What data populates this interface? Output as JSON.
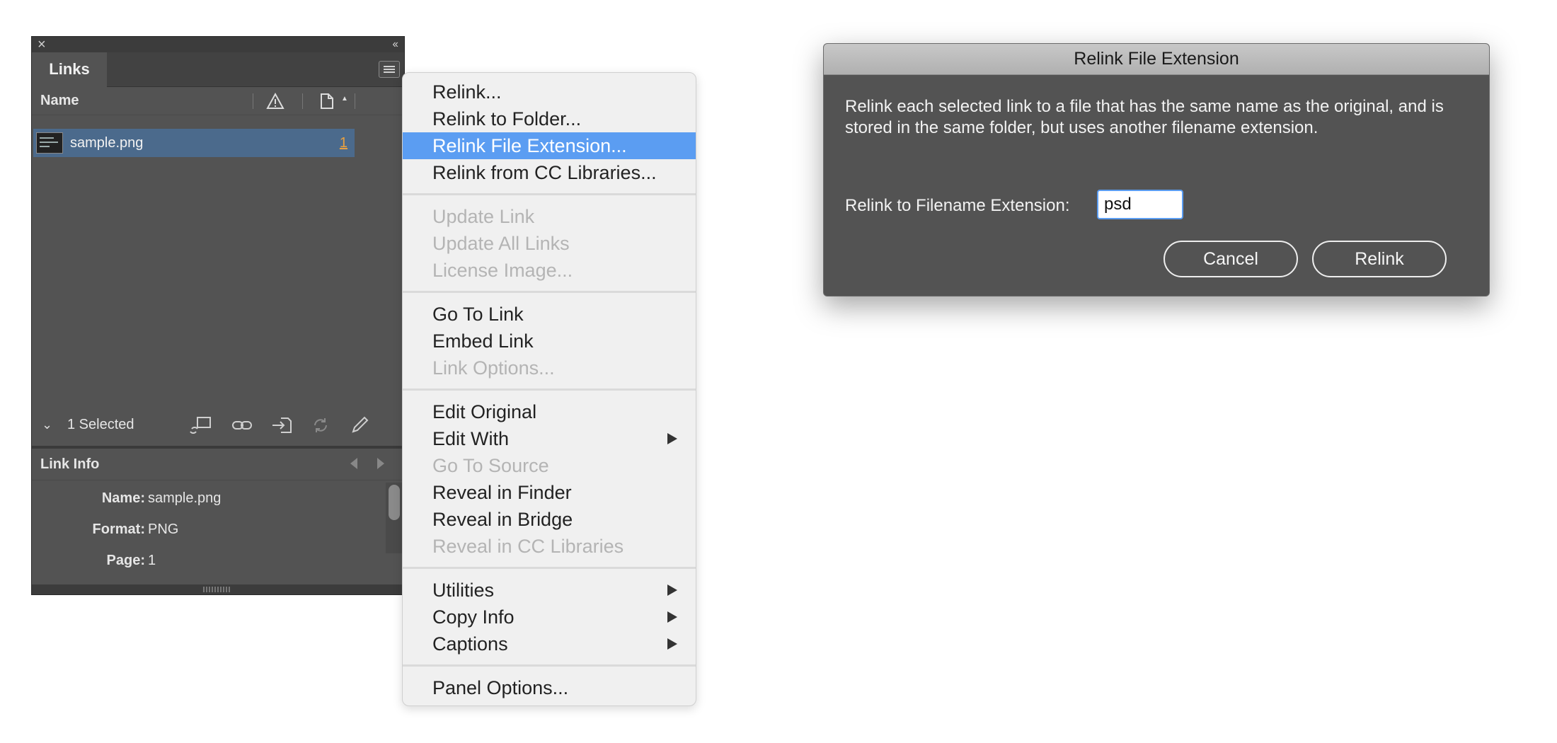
{
  "links_panel": {
    "tab_label": "Links",
    "column_name_label": "Name",
    "link": {
      "filename": "sample.png",
      "page": "1"
    },
    "selected_count_text": "1 Selected",
    "link_info": {
      "title": "Link Info",
      "name_key": "Name:",
      "name_value": "sample.png",
      "format_key": "Format:",
      "format_value": "PNG",
      "page_key": "Page:",
      "page_value": "1"
    }
  },
  "context_menu": {
    "items": [
      {
        "label": "Relink...",
        "state": "enabled"
      },
      {
        "label": "Relink to Folder...",
        "state": "enabled"
      },
      {
        "label": "Relink File Extension...",
        "state": "highlighted"
      },
      {
        "label": "Relink from CC Libraries...",
        "state": "enabled"
      },
      {
        "label": "Update Link",
        "state": "disabled"
      },
      {
        "label": "Update All Links",
        "state": "disabled"
      },
      {
        "label": "License Image...",
        "state": "disabled"
      },
      {
        "label": "Go To Link",
        "state": "enabled"
      },
      {
        "label": "Embed Link",
        "state": "enabled"
      },
      {
        "label": "Link Options...",
        "state": "disabled"
      },
      {
        "label": "Edit Original",
        "state": "enabled"
      },
      {
        "label": "Edit With",
        "state": "enabled",
        "submenu": true
      },
      {
        "label": "Go To Source",
        "state": "disabled"
      },
      {
        "label": "Reveal in Finder",
        "state": "enabled"
      },
      {
        "label": "Reveal in Bridge",
        "state": "enabled"
      },
      {
        "label": "Reveal in CC Libraries",
        "state": "disabled"
      },
      {
        "label": "Utilities",
        "state": "enabled",
        "submenu": true
      },
      {
        "label": "Copy Info",
        "state": "enabled",
        "submenu": true
      },
      {
        "label": "Captions",
        "state": "enabled",
        "submenu": true
      },
      {
        "label": "Panel Options...",
        "state": "enabled"
      }
    ],
    "highlight_color": "#5b9df2"
  },
  "dialog": {
    "title": "Relink File Extension",
    "description": "Relink each selected link to a file that has the same name as the original, and is stored in the same folder, but uses another filename extension.",
    "extension_label": "Relink to Filename Extension:",
    "extension_value": "psd",
    "cancel_label": "Cancel",
    "relink_label": "Relink"
  }
}
